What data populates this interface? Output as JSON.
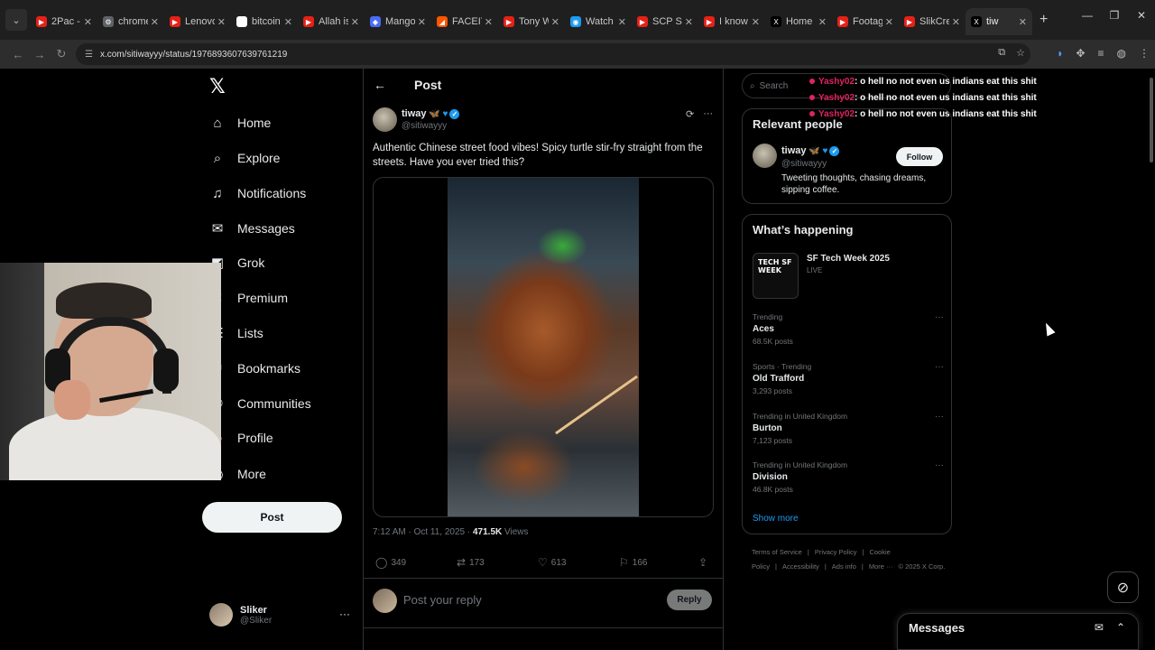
{
  "browser": {
    "tabs": [
      {
        "label": "2Pac - ",
        "fav_color": "#e62117",
        "fav": "▶"
      },
      {
        "label": "chrome",
        "fav_color": "#5f6368",
        "fav": "⚙"
      },
      {
        "label": "Lenovo",
        "fav_color": "#e62117",
        "fav": "▶"
      },
      {
        "label": "bitcoin",
        "fav_color": "#ffffff",
        "fav": "G"
      },
      {
        "label": "Allah is",
        "fav_color": "#e62117",
        "fav": "▶"
      },
      {
        "label": "Mango",
        "fav_color": "#4a6cf7",
        "fav": "◆"
      },
      {
        "label": "FACEIT",
        "fav_color": "#ff5500",
        "fav": "◢"
      },
      {
        "label": "Tony W",
        "fav_color": "#e62117",
        "fav": "▶"
      },
      {
        "label": "Watch",
        "fav_color": "#1d9bf0",
        "fav": "◉"
      },
      {
        "label": "SCP SE",
        "fav_color": "#e62117",
        "fav": "▶"
      },
      {
        "label": "I know",
        "fav_color": "#e62117",
        "fav": "▶"
      },
      {
        "label": "Home",
        "fav_color": "#000000",
        "fav": "X"
      },
      {
        "label": "Footag",
        "fav_color": "#e62117",
        "fav": "▶"
      },
      {
        "label": "SlikCre",
        "fav_color": "#e62117",
        "fav": "▶"
      },
      {
        "label": "tiw",
        "fav_color": "#000000",
        "fav": "X"
      }
    ],
    "url": "x.com/sitiwayyy/status/1976893607639761219"
  },
  "nav": {
    "items": [
      {
        "label": "Home",
        "icon": "⌂"
      },
      {
        "label": "Explore",
        "icon": "⌕"
      },
      {
        "label": "Notifications",
        "icon": "♫"
      },
      {
        "label": "Messages",
        "icon": "✉"
      },
      {
        "label": "Grok",
        "icon": "◩"
      },
      {
        "label": "Premium",
        "icon": "✕"
      },
      {
        "label": "Lists",
        "icon": "☰"
      },
      {
        "label": "Bookmarks",
        "icon": "⚑"
      },
      {
        "label": "Communities",
        "icon": "⚇"
      },
      {
        "label": "Profile",
        "icon": "☺"
      },
      {
        "label": "More",
        "icon": "◎"
      }
    ],
    "post_button": "Post",
    "account": {
      "name": "Sliker",
      "handle": "@Sliker"
    }
  },
  "post": {
    "header": "Post",
    "author_name": "tiway",
    "author_handle": "@sitiwayyy",
    "text": "Authentic Chinese street food vibes! Spicy turtle stir-fry straight from the streets. Have you ever tried this?",
    "time": "7:12 AM · Oct 11, 2025 · ",
    "views_count": "471.5K",
    "views_label": " Views",
    "replies": "349",
    "reposts": "173",
    "likes": "613",
    "bookmarks": "166",
    "reply_placeholder": "Post your reply",
    "reply_button": "Reply"
  },
  "sidebar": {
    "search_placeholder": "Search",
    "chat": [
      {
        "user": "Yashy02",
        "msg": ": o hell no not even us indians eat this shit"
      },
      {
        "user": "Yashy02",
        "msg": ": o hell no not even us indians eat this shit"
      },
      {
        "user": "Yashy02",
        "msg": ": o hell no not even us indians eat this shit"
      }
    ],
    "relevant": {
      "title": "Relevant people",
      "name": "tiway",
      "handle": "@sitiwayyy",
      "follow": "Follow",
      "bio": "Tweeting thoughts, chasing dreams, sipping coffee."
    },
    "happening": {
      "title": "What’s happening",
      "event_title": "SF Tech Week 2025",
      "event_status": "LIVE",
      "event_image_text": "TECH SF WEEK",
      "trends": [
        {
          "context": "Trending",
          "title": "Aces",
          "count": "68.5K posts"
        },
        {
          "context": "Sports · Trending",
          "title": "Old Trafford",
          "count": "3,293 posts"
        },
        {
          "context": "Trending in United Kingdom",
          "title": "Burton",
          "count": "7,123 posts"
        },
        {
          "context": "Trending in United Kingdom",
          "title": "Division",
          "count": "46.8K posts"
        }
      ],
      "show_more": "Show more"
    },
    "footer": [
      "Terms of Service",
      "|",
      "Privacy Policy",
      "|",
      "Cookie Policy",
      "|",
      "Accessibility",
      "|",
      "Ads info",
      "|",
      "More ···",
      "© 2025 X Corp."
    ]
  },
  "messages_drawer": {
    "title": "Messages"
  }
}
